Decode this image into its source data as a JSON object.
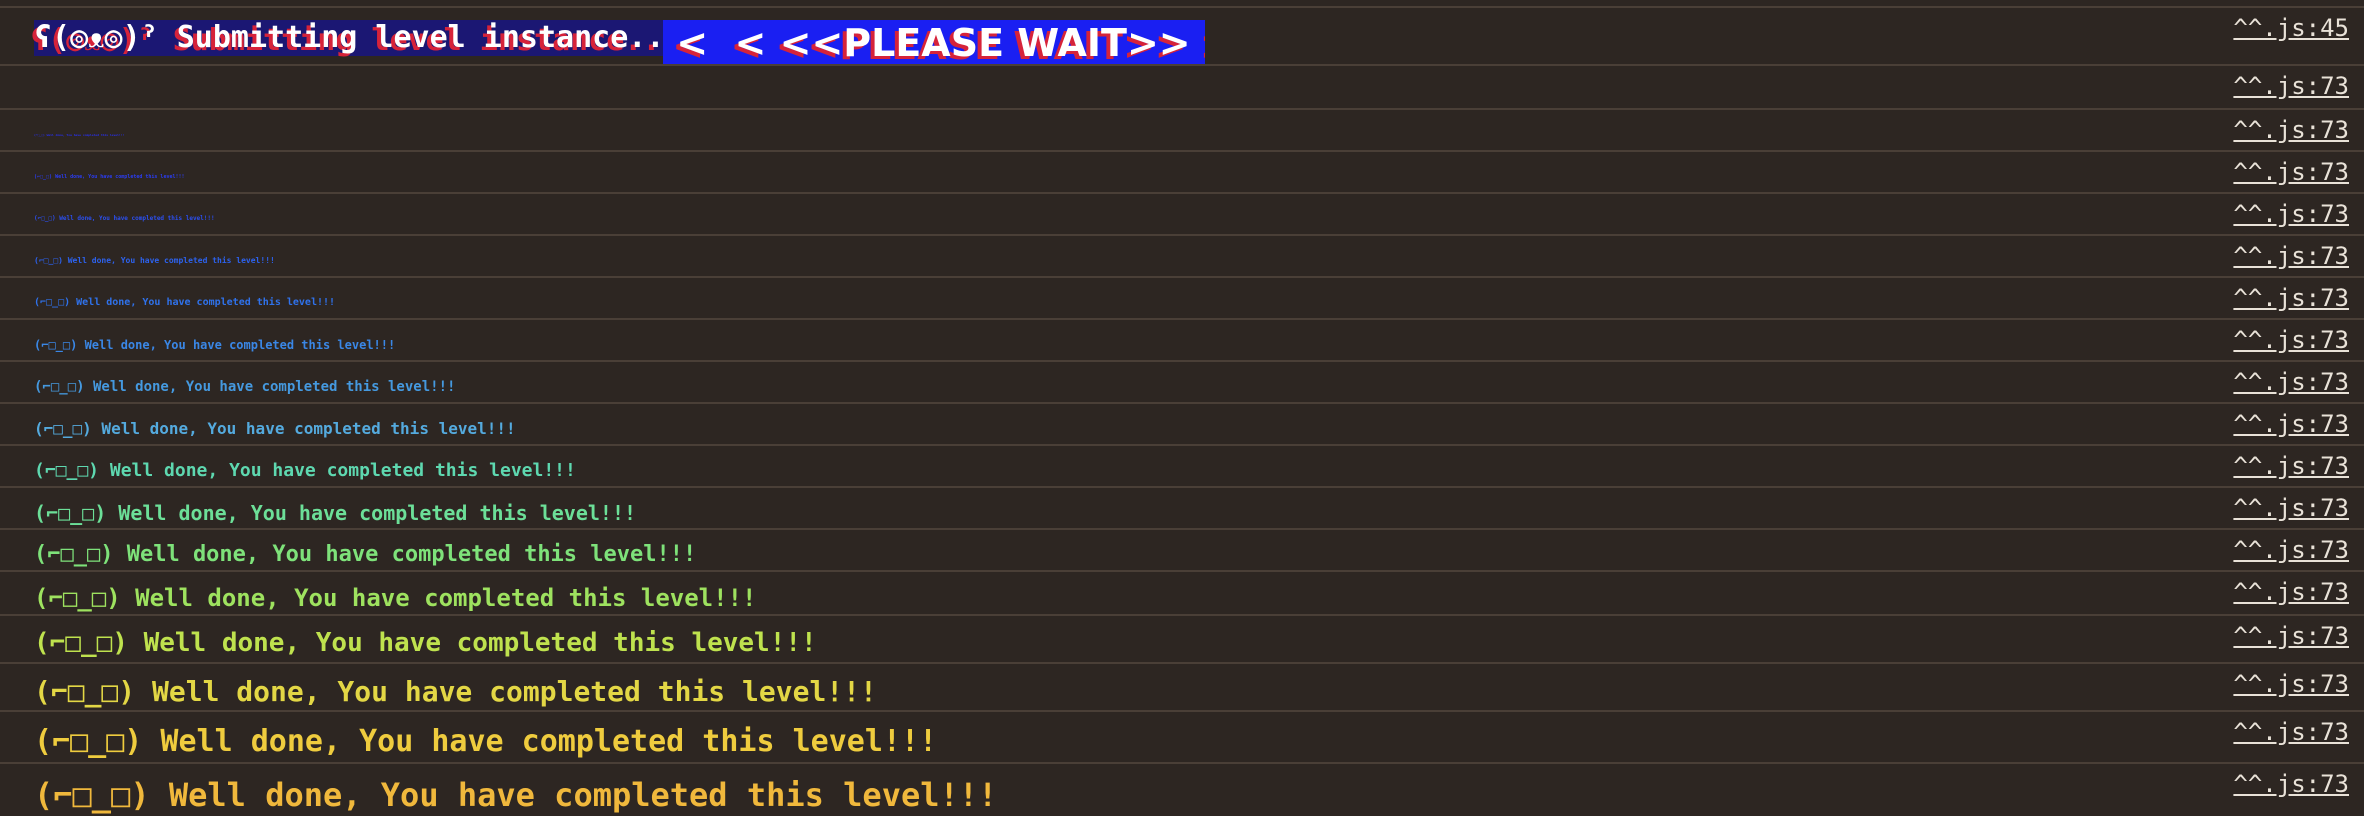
{
  "header": {
    "submitting_text": "ʕ(◎ᴥ◎)ˀ Submitting level instance...",
    "please_wait_text": " <  < <<PLEASE WAIT>> >  >",
    "source": "^^.js:45"
  },
  "rows": [
    {
      "text": "",
      "source": "^^.js:73",
      "color": "#1a1ff2"
    },
    {
      "text": "(⌐□_□) Well done, You have completed this level!!!",
      "source": "^^.js:73",
      "color": "#2830f4"
    },
    {
      "text": "(⌐□_□) Well done, You have completed this level!!!",
      "source": "^^.js:73",
      "color": "#2a3cf2"
    },
    {
      "text": "(⌐□_□) Well done, You have completed this level!!!",
      "source": "^^.js:73",
      "color": "#2b4ff0"
    },
    {
      "text": "(⌐□_□) Well done, You have completed this level!!!",
      "source": "^^.js:73",
      "color": "#2d62ee"
    },
    {
      "text": "(⌐□_□) Well done, You have completed this level!!!",
      "source": "^^.js:73",
      "color": "#2f72ec"
    },
    {
      "text": "(⌐□_□) Well done, You have completed this level!!!",
      "source": "^^.js:73",
      "color": "#3a87e6"
    },
    {
      "text": "(⌐□_□) Well done, You have completed this level!!!",
      "source": "^^.js:73",
      "color": "#4599df"
    },
    {
      "text": "(⌐□_□) Well done, You have completed this level!!!",
      "source": "^^.js:73",
      "color": "#54aade"
    },
    {
      "text": "(⌐□_□) Well done, You have completed this level!!!",
      "source": "^^.js:73",
      "color": "#5ed8b0"
    },
    {
      "text": "(⌐□_□) Well done, You have completed this level!!!",
      "source": "^^.js:73",
      "color": "#6cdf98"
    },
    {
      "text": "(⌐□_□) Well done, You have completed this level!!!",
      "source": "^^.js:73",
      "color": "#7ee27a"
    },
    {
      "text": "(⌐□_□) Well done, You have completed this level!!!",
      "source": "^^.js:73",
      "color": "#9ee25f"
    },
    {
      "text": "(⌐□_□) Well done, You have completed this level!!!",
      "source": "^^.js:73",
      "color": "#bfe24e"
    },
    {
      "text": "(⌐□_□) Well done, You have completed this level!!!",
      "source": "^^.js:73",
      "color": "#e3d745"
    },
    {
      "text": "(⌐□_□) Well done, You have completed this level!!!",
      "source": "^^.js:73",
      "color": "#efcc3e"
    },
    {
      "text": "(⌐□_□) Well done, You have completed this level!!!",
      "source": "^^.js:73",
      "color": "#f0b83c"
    }
  ]
}
